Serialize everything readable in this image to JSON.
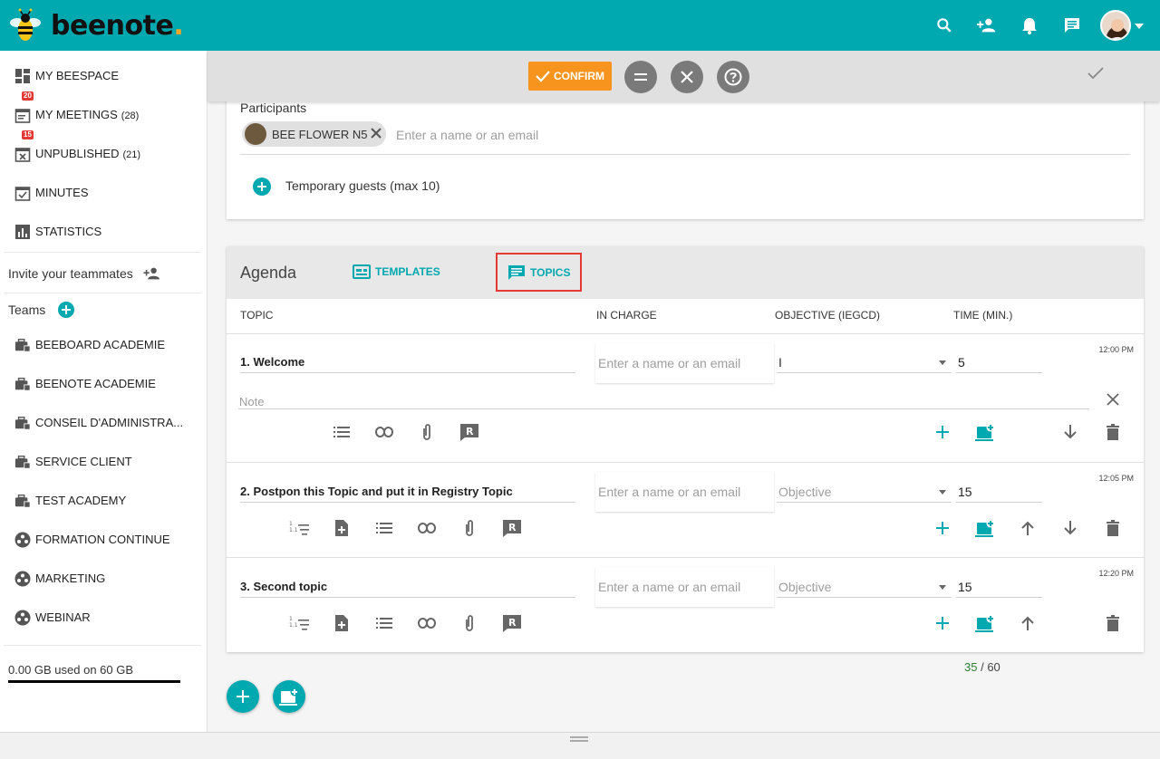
{
  "app": {
    "logo_text": "beenote",
    "logo_dot": ".",
    "brand_color": "#00a8b0",
    "accent_color": "#f7941d"
  },
  "topbar": {
    "icons": [
      "search-icon",
      "add-person-icon",
      "bell-icon",
      "chat-icon",
      "avatar",
      "dropdown-icon"
    ]
  },
  "sidebar": {
    "items": [
      {
        "label": "MY BEESPACE",
        "count": "",
        "badge": "",
        "icon": "dashboard-icon"
      },
      {
        "label": "MY MEETINGS",
        "count": "(28)",
        "badge": "20",
        "icon": "calendar-icon"
      },
      {
        "label": "UNPUBLISHED",
        "count": "(21)",
        "badge": "15",
        "icon": "calendar-x-icon"
      },
      {
        "label": "MINUTES",
        "count": "",
        "badge": "",
        "icon": "calendar-check-icon"
      },
      {
        "label": "STATISTICS",
        "count": "",
        "badge": "",
        "icon": "bar-chart-icon"
      }
    ],
    "invite_label": "Invite your teammates",
    "teams_label": "Teams",
    "teams": [
      {
        "label": "BEEBOARD ACADEMIE",
        "icon": "briefcase-lock-icon"
      },
      {
        "label": "BEENOTE ACADEMIE",
        "icon": "briefcase-lock-icon"
      },
      {
        "label": "CONSEIL D'ADMINISTRA...",
        "icon": "briefcase-lock-icon"
      },
      {
        "label": "SERVICE CLIENT",
        "icon": "briefcase-lock-icon"
      },
      {
        "label": "TEST ACADEMY",
        "icon": "briefcase-lock-icon"
      },
      {
        "label": "FORMATION CONTINUE",
        "icon": "group-icon"
      },
      {
        "label": "MARKETING",
        "icon": "group-icon"
      },
      {
        "label": "WEBINAR",
        "icon": "group-icon"
      }
    ],
    "storage": "0.00 GB used on 60 GB"
  },
  "actionbar": {
    "confirm_label": "CONFIRM"
  },
  "participants": {
    "label": "Participants",
    "chip_name": "BEE FLOWER N5",
    "input_placeholder": "Enter a name or an email",
    "temp_guests": "Temporary guests (max 10)"
  },
  "agenda": {
    "title": "Agenda",
    "tabs": {
      "templates": "TEMPLATES",
      "topics": "TOPICS"
    },
    "columns": {
      "topic": "TOPIC",
      "in_charge": "IN CHARGE",
      "objective": "OBJECTIVE (IEGCD)",
      "time": "TIME (MIN.)"
    },
    "incharge_placeholder": "Enter a name or an email",
    "objective_placeholder": "Objective",
    "note_placeholder": "Note",
    "topics": [
      {
        "title": "1. Welcome",
        "objective": "I",
        "time": "5",
        "clock": "12:00 PM"
      },
      {
        "title": "2. Postpon this Topic and put it in Registry Topic",
        "objective": "",
        "time": "15",
        "clock": "12:05 PM"
      },
      {
        "title": "3. Second topic",
        "objective": "",
        "time": "15",
        "clock": "12:20 PM"
      }
    ],
    "total_used": "35",
    "total_sep": " / ",
    "total_max": "60"
  }
}
